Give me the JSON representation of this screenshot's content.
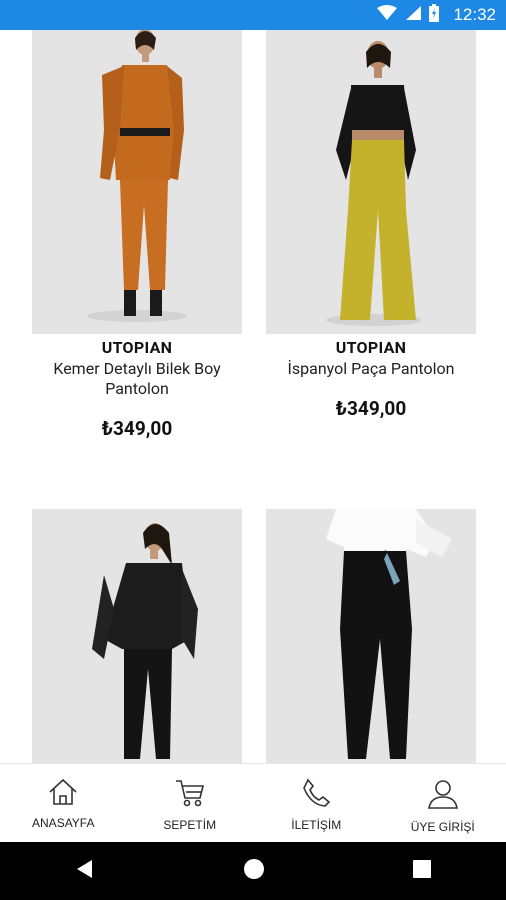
{
  "status_bar": {
    "time": "12:32",
    "icons": [
      "wifi-icon",
      "cell-signal-icon",
      "battery-icon"
    ]
  },
  "products": [
    {
      "brand": "UTOPIAN",
      "name": "Kemer Detaylı Bilek Boy Pantolon",
      "price": "₺349,00",
      "image": "orange-suit-model"
    },
    {
      "brand": "UTOPIAN",
      "name": "İspanyol Paça Pantolon",
      "price": "₺349,00",
      "image": "black-top-yellow-flare-pants-model"
    },
    {
      "brand": "",
      "name": "",
      "price": "",
      "image": "black-blouse-black-pants-model"
    },
    {
      "brand": "",
      "name": "",
      "price": "",
      "image": "white-shirt-black-pants-model"
    }
  ],
  "bottom_nav": {
    "items": [
      {
        "label": "ANASAYFA",
        "icon": "home-icon"
      },
      {
        "label": "SEPETİM",
        "icon": "cart-icon"
      },
      {
        "label": "İLETİŞİM",
        "icon": "phone-icon"
      },
      {
        "label": "ÜYE GİRİŞİ",
        "icon": "user-icon"
      }
    ]
  },
  "android_nav": [
    "back-icon",
    "home-circle-icon",
    "recents-icon"
  ],
  "colors": {
    "status_bar": "#1e88e5",
    "image_bg": "#e6e6e6"
  }
}
